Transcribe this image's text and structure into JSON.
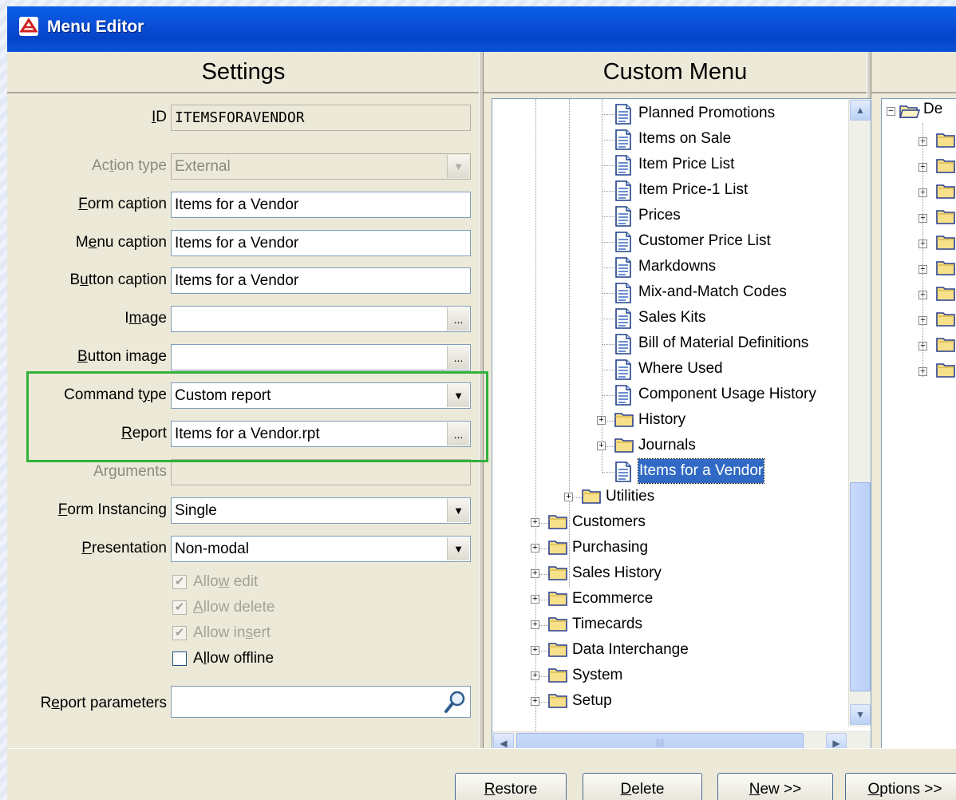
{
  "window": {
    "title": "Menu Editor"
  },
  "panels": {
    "settings": "Settings",
    "custom_menu": "Custom Menu"
  },
  "settings": {
    "id": {
      "label_pre": "",
      "label_u": "I",
      "label_post": "D",
      "value": "ITEMSFORAVENDOR"
    },
    "action_type": {
      "label_pre": "Ac",
      "label_u": "t",
      "label_post": "ion type",
      "value": "External"
    },
    "form_caption": {
      "label_pre": "",
      "label_u": "F",
      "label_post": "orm caption",
      "value": "Items for a Vendor"
    },
    "menu_caption": {
      "label_pre": "M",
      "label_u": "e",
      "label_post": "nu caption",
      "value": "Items for a Vendor"
    },
    "button_caption": {
      "label_pre": "B",
      "label_u": "u",
      "label_post": "tton caption",
      "value": "Items for a Vendor"
    },
    "image": {
      "label_pre": "I",
      "label_u": "m",
      "label_post": "age",
      "value": ""
    },
    "button_image": {
      "label_pre": "",
      "label_u": "B",
      "label_post": "utton image",
      "value": ""
    },
    "command_type": {
      "label_pre": "Command t",
      "label_u": "y",
      "label_post": "pe",
      "value": "Custom report"
    },
    "report": {
      "label_pre": "",
      "label_u": "R",
      "label_post": "eport",
      "value": "Items for a Vendor.rpt"
    },
    "arguments": {
      "label": "Arguments",
      "value": ""
    },
    "form_instancing": {
      "label_pre": "",
      "label_u": "F",
      "label_post": "orm Instancing",
      "value": "Single"
    },
    "presentation": {
      "label_pre": "",
      "label_u": "P",
      "label_post": "resentation",
      "value": "Non-modal"
    },
    "allow_edit": {
      "label_pre": "Allo",
      "label_u": "w",
      "label_post": " edit",
      "checked": true
    },
    "allow_delete": {
      "label_pre": "",
      "label_u": "A",
      "label_post": "llow delete",
      "checked": true
    },
    "allow_insert": {
      "label_pre": "Allow in",
      "label_u": "s",
      "label_post": "ert",
      "checked": true
    },
    "allow_offline": {
      "label_pre": "A",
      "label_u": "l",
      "label_post": "low offline",
      "checked": false
    },
    "report_parameters": {
      "label_pre": "R",
      "label_u": "e",
      "label_post": "port parameters",
      "value": ""
    },
    "ellipsis": "...",
    "checkmark": "✔"
  },
  "tree": {
    "items": [
      {
        "label": "Planned Promotions",
        "icon": "document-icon"
      },
      {
        "label": "Items on Sale",
        "icon": "document-icon"
      },
      {
        "label": "Item Price List",
        "icon": "document-icon"
      },
      {
        "label": "Item Price-1 List",
        "icon": "document-icon"
      },
      {
        "label": "Prices",
        "icon": "document-icon"
      },
      {
        "label": "Customer Price List",
        "icon": "document-icon"
      },
      {
        "label": "Markdowns",
        "icon": "document-icon"
      },
      {
        "label": "Mix-and-Match Codes",
        "icon": "document-icon"
      },
      {
        "label": "Sales Kits",
        "icon": "document-icon"
      },
      {
        "label": "Bill of Material Definitions",
        "icon": "document-icon"
      },
      {
        "label": "Where Used",
        "icon": "document-icon"
      },
      {
        "label": "Component Usage History",
        "icon": "document-icon"
      },
      {
        "label": "History",
        "icon": "folder-icon"
      },
      {
        "label": "Journals",
        "icon": "folder-icon"
      },
      {
        "label": "Items for a Vendor",
        "icon": "document-icon",
        "selected": true
      },
      {
        "label": "Utilities",
        "icon": "folder-icon"
      },
      {
        "label": "Customers",
        "icon": "folder-icon"
      },
      {
        "label": "Purchasing",
        "icon": "folder-icon"
      },
      {
        "label": "Sales History",
        "icon": "folder-icon"
      },
      {
        "label": "Ecommerce",
        "icon": "folder-icon"
      },
      {
        "label": "Timecards",
        "icon": "folder-icon"
      },
      {
        "label": "Data Interchange",
        "icon": "folder-icon"
      },
      {
        "label": "System",
        "icon": "folder-icon"
      },
      {
        "label": "Setup",
        "icon": "folder-icon"
      }
    ],
    "expander_plus": "+",
    "expander_minus": "−",
    "right_root_label": "De"
  },
  "buttons": {
    "restore": {
      "pre": "",
      "u": "R",
      "post": "estore"
    },
    "delete": {
      "pre": "",
      "u": "D",
      "post": "elete"
    },
    "new": {
      "pre": "",
      "u": "N",
      "post": "ew >>"
    },
    "options": {
      "pre": "",
      "u": "O",
      "post": "ptions >>"
    }
  },
  "colors": {
    "highlight": "#31b13a",
    "selection": "#316ac5",
    "title_bar": "#0a52d8"
  }
}
